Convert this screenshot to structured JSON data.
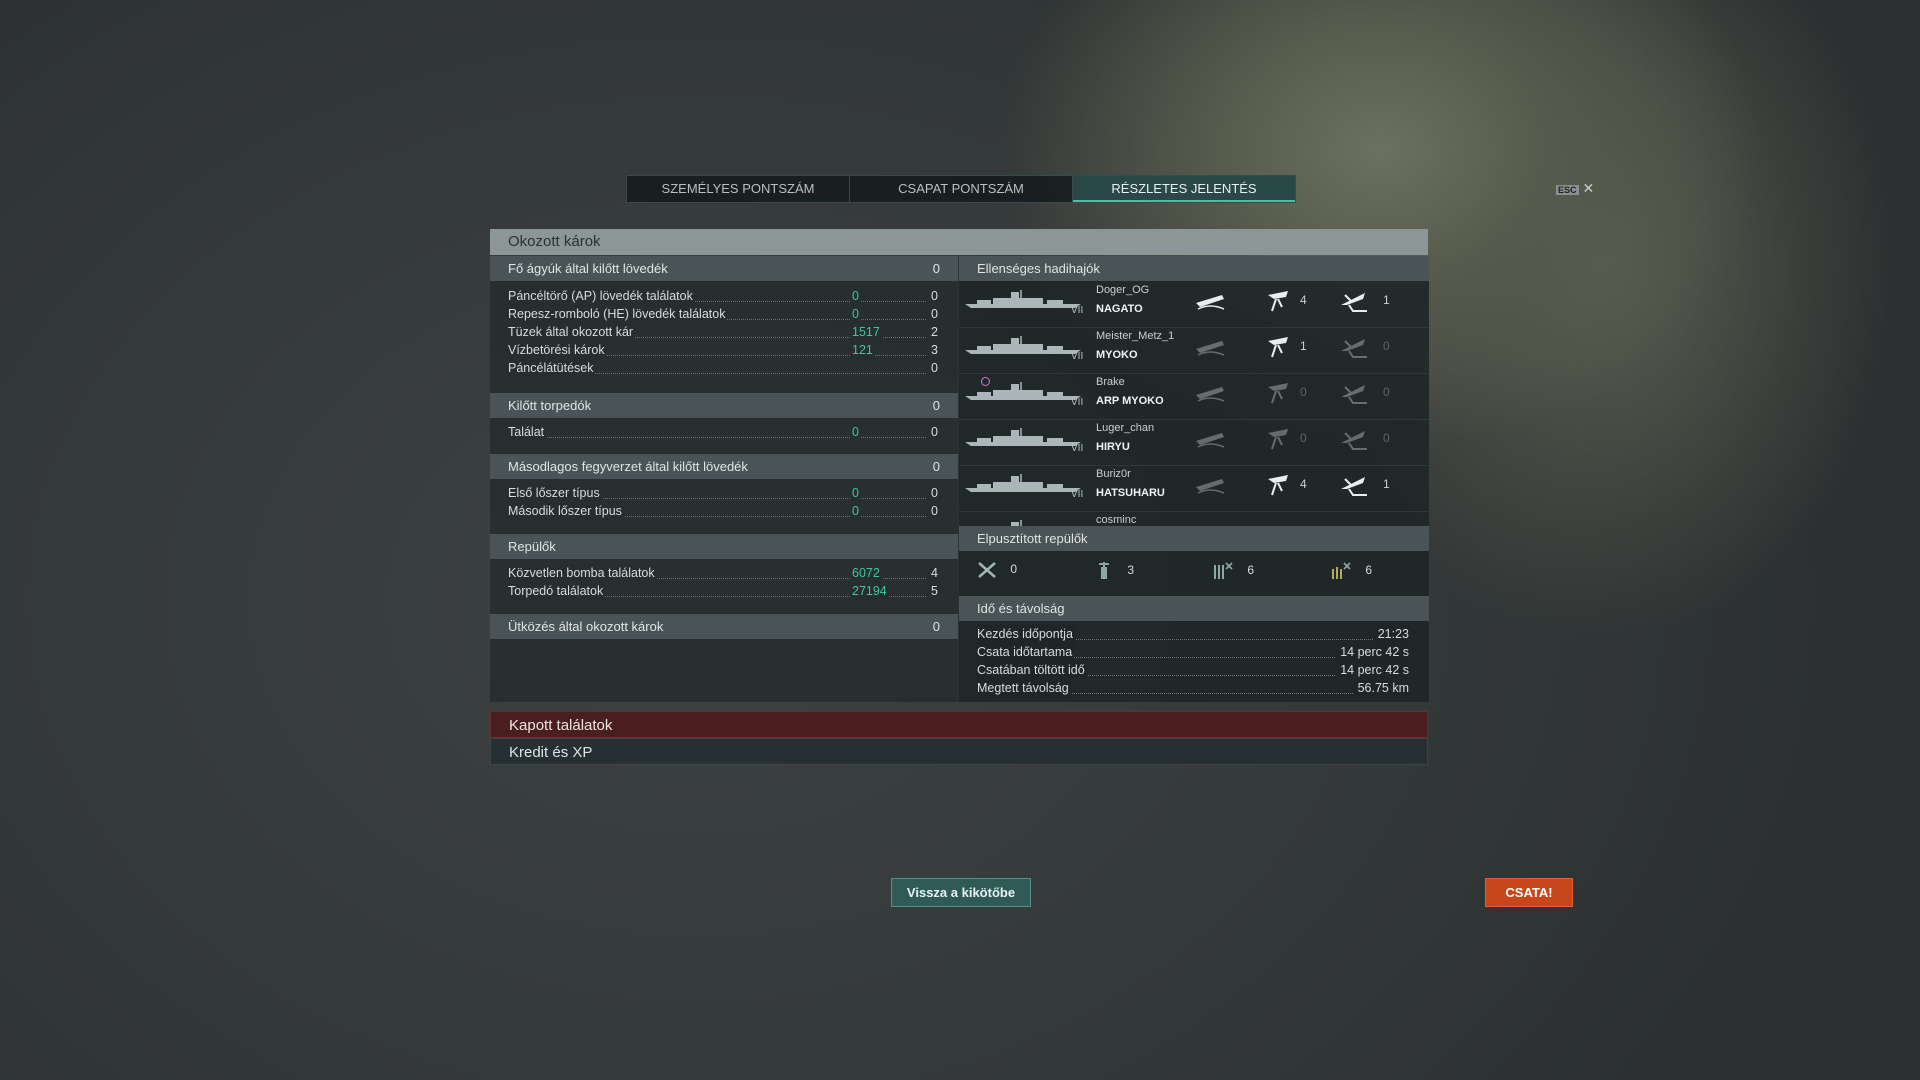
{
  "tabs": {
    "personal": "SZEMÉLYES PONTSZÁM",
    "team": "CSAPAT PONTSZÁM",
    "detailed": "RÉSZLETES JELENTÉS"
  },
  "esc": {
    "key": "ESC",
    "close": "✕"
  },
  "damage": {
    "title": "Okozott károk",
    "main_battery": {
      "label": "Fő ágyúk által kilőtt lövedék",
      "value": "0",
      "rows": [
        {
          "label": "Páncéltörő (AP) lövedék találatok",
          "v1": "0",
          "v2": "0"
        },
        {
          "label": "Repesz-romboló (HE) lövedék találatok",
          "v1": "0",
          "v2": "0"
        },
        {
          "label": "Tüzek által okozott kár",
          "v1": "1517",
          "v2": "2"
        },
        {
          "label": "Vízbetörési károk",
          "v1": "121",
          "v2": "3"
        },
        {
          "label": "Páncélátütések",
          "v1": "",
          "v2": "0"
        }
      ]
    },
    "torpedoes": {
      "label": "Kilőtt torpedók",
      "value": "0",
      "rows": [
        {
          "label": "Találat",
          "v1": "0",
          "v2": "0"
        }
      ]
    },
    "secondary": {
      "label": "Másodlagos fegyverzet által kilőtt lövedék",
      "value": "0",
      "rows": [
        {
          "label": "Első lőszer típus",
          "v1": "0",
          "v2": "0"
        },
        {
          "label": "Második lőszer típus",
          "v1": "0",
          "v2": "0"
        }
      ]
    },
    "planes": {
      "label": "Repülők",
      "rows": [
        {
          "label": "Közvetlen bomba találatok",
          "v1": "6072",
          "v2": "4"
        },
        {
          "label": "Torpedó találatok",
          "v1": "27194",
          "v2": "5"
        }
      ]
    },
    "ramming": {
      "label": "Ütközés által okozott károk",
      "value": "0"
    }
  },
  "enemy": {
    "title": "Ellenséges hadihajók",
    "ships": [
      {
        "player": "Doger_OG",
        "ship": "NAGATO",
        "tier": "VII",
        "torp": "4",
        "bomb": "1",
        "sunk": true
      },
      {
        "player": "Meister_Metz_1",
        "ship": "MYOKO",
        "tier": "VII",
        "torp": "1",
        "bomb": "0",
        "sunk": false
      },
      {
        "player": "Brake",
        "ship": "ARP MYOKO",
        "tier": "VII",
        "torp": "0",
        "bomb": "0",
        "sunk": false
      },
      {
        "player": "Luger_chan",
        "ship": "HIRYU",
        "tier": "VII",
        "torp": "0",
        "bomb": "0",
        "sunk": false
      },
      {
        "player": "Buriz0r",
        "ship": "HATSUHARU",
        "tier": "VII",
        "torp": "4",
        "bomb": "1",
        "sunk": false
      },
      {
        "player": "cosminc",
        "ship": "",
        "tier": "",
        "torp": "",
        "bomb": "",
        "sunk": false
      }
    ]
  },
  "planes_destroyed": {
    "title": "Elpusztított repülők",
    "fighter": "0",
    "dive": "3",
    "aa1": "6",
    "aa2": "6"
  },
  "time": {
    "title": "Idő és távolság",
    "rows": [
      {
        "label": "Kezdés időpontja",
        "value": "21:23"
      },
      {
        "label": "Csata időtartama",
        "value": "14 perc 42 s"
      },
      {
        "label": "Csatában töltött idő",
        "value": "14 perc 42 s"
      },
      {
        "label": "Megtett távolság",
        "value": "56.75 km"
      }
    ]
  },
  "received": "Kapott találatok",
  "credits": "Kredit és XP",
  "buttons": {
    "port": "Vissza a kikötőbe",
    "battle": "CSATA!"
  },
  "colors": {
    "accent": "#3ec8a0",
    "battle": "#c8461a",
    "received": "#4a1e1e"
  }
}
